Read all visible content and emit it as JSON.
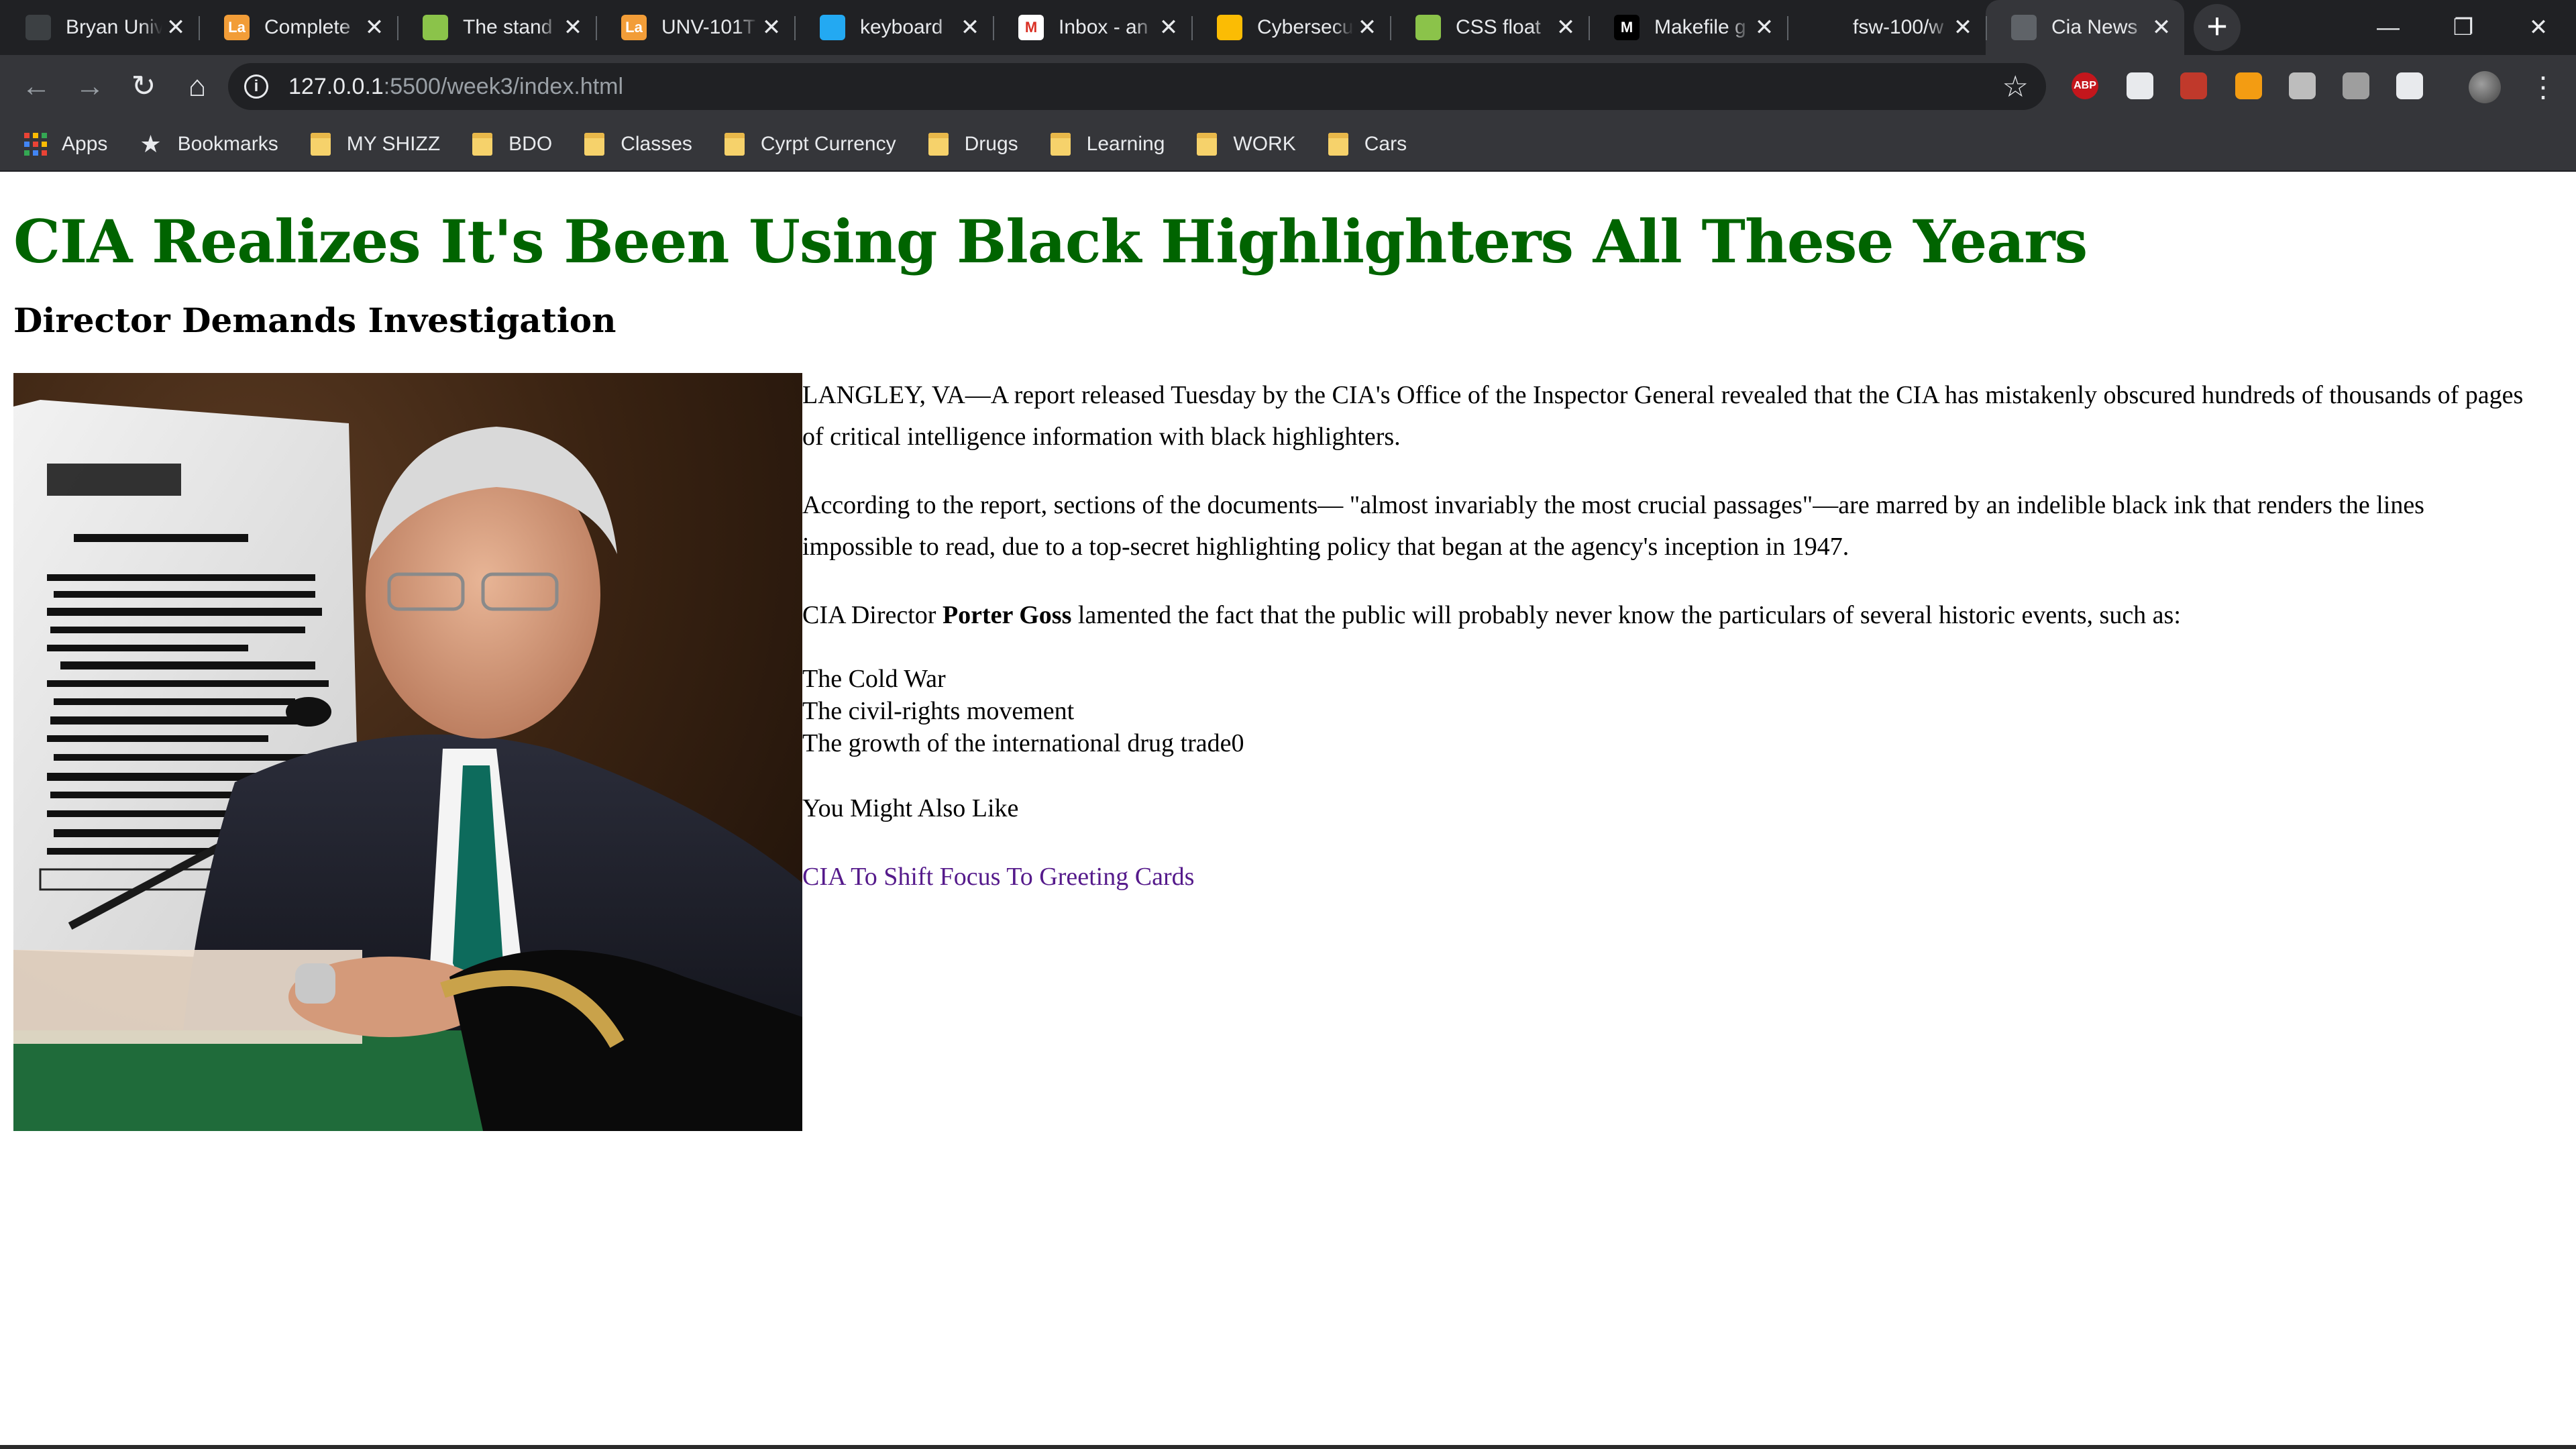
{
  "tabs": [
    {
      "title": "Bryan Univ",
      "favicon_color": "#3c4043",
      "favicon_text": "",
      "active": false
    },
    {
      "title": "Complete",
      "favicon_color": "#f29d38",
      "favicon_text": "Lа",
      "active": false
    },
    {
      "title": "The stand",
      "favicon_color": "#8bc34a",
      "favicon_text": "",
      "active": false
    },
    {
      "title": "UNV-101T",
      "favicon_color": "#f29d38",
      "favicon_text": "Lа",
      "active": false
    },
    {
      "title": "keyboard",
      "favicon_color": "#23a9f2",
      "favicon_text": "",
      "active": false
    },
    {
      "title": "Inbox - an",
      "favicon_color": "#ffffff",
      "favicon_text": "M",
      "active": false
    },
    {
      "title": "Cybersecu",
      "favicon_color": "#fbbc04",
      "favicon_text": "",
      "active": false
    },
    {
      "title": "CSS float",
      "favicon_color": "#8bc34a",
      "favicon_text": "",
      "active": false
    },
    {
      "title": "Makefile g",
      "favicon_color": "#000000",
      "favicon_text": "M",
      "active": false
    },
    {
      "title": "fsw-100/w",
      "favicon_color": "#202124",
      "favicon_text": "",
      "active": false
    },
    {
      "title": "Cia News",
      "favicon_color": "#5f6368",
      "favicon_text": "",
      "active": true
    }
  ],
  "toolbar": {
    "url_host": "127.0.0.1",
    "url_path": ":5500/week3/index.html"
  },
  "bookmarks": {
    "apps_label": "Apps",
    "bookmarks_label": "Bookmarks",
    "folders": [
      "MY SHIZZ",
      "BDO",
      "Classes",
      "Cyrpt Currency",
      "Drugs",
      "Learning",
      "WORK",
      "Cars"
    ]
  },
  "extensions": [
    {
      "name": "adblock-icon",
      "color": "#c4161c",
      "text": "ABP"
    },
    {
      "name": "ghostery-icon",
      "color": "#e8eaed",
      "text": ""
    },
    {
      "name": "bookmark-ext-icon",
      "color": "#c0392b",
      "text": ""
    },
    {
      "name": "orange-ext-icon",
      "color": "#f39c12",
      "text": ""
    },
    {
      "name": "grey-ext-icon",
      "color": "#bdbdbd",
      "text": ""
    },
    {
      "name": "shield-ext-icon",
      "color": "#9e9e9e",
      "text": ""
    },
    {
      "name": "screenshot-ext-icon",
      "color": "#e8eaed",
      "text": ""
    }
  ],
  "article": {
    "headline": "CIA Realizes It's Been Using Black Highlighters All These Years",
    "subhead": "Director Demands Investigation",
    "p1": "LANGLEY, VA—A report released Tuesday by the CIA's Office of the Inspector General revealed that the CIA has mistakenly obscured hundreds of thousands of pages of critical intelligence information with black highlighters.",
    "p2": "According to the report, sections of the documents— \"almost invariably the most crucial passages\"—are marred by an indelible black ink that renders the lines impossible to read, due to a top-secret highlighting policy that began at the agency's inception in 1947.",
    "p3_before": "CIA Director ",
    "p3_bold": "Porter Goss",
    "p3_after": " lamented the fact that the public will probably never know the particulars of several historic events, such as:",
    "events": [
      "The Cold War",
      "The civil-rights movement",
      "The growth of the international drug trade0"
    ],
    "related_label": "You Might Also Like",
    "related_link": "CIA To Shift Focus To Greeting Cards"
  }
}
